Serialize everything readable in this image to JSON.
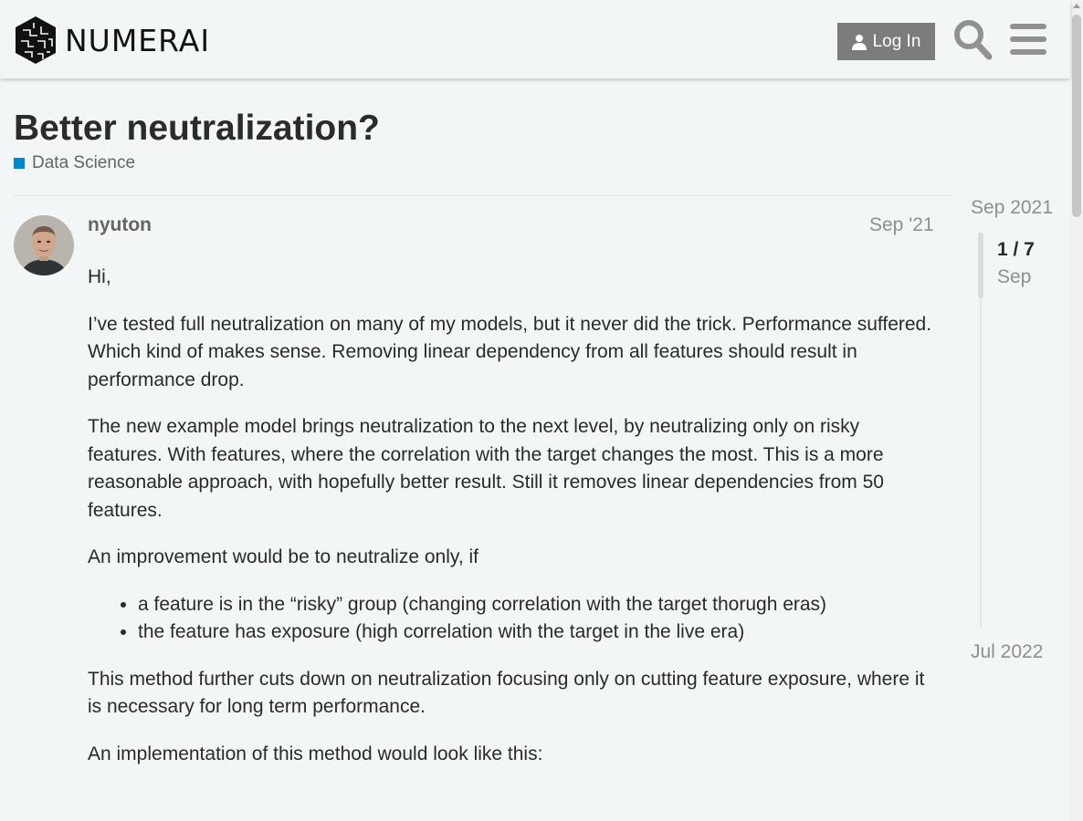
{
  "header": {
    "logo_text": "NUMERAI",
    "login_label": "Log In"
  },
  "topic": {
    "title": "Better neutralization?",
    "category": "Data Science",
    "category_color": "#0088cc"
  },
  "post": {
    "username": "nyuton",
    "date": "Sep '21",
    "greeting": "Hi,",
    "p1_line1": "I’ve tested full neutralization on many of my models, but it never did the trick. Performance suffered.",
    "p1_line2": "Which kind of makes sense. Removing linear dependency from all features should result in performance drop.",
    "p2": "The new example model brings neutralization to the next level, by neutralizing only on risky features. With features, where the correlation with the target changes the most. This is a more reasonable approach, with hopefully better result. Still it removes linear dependencies from 50 features.",
    "p3": "An improvement would be to neutralize only, if",
    "list": [
      "a feature is in the “risky” group (changing correlation with the target thorugh eras)",
      "the feature has exposure (high correlation with the target in the live era)"
    ],
    "p4": "This method further cuts down on neutralization focusing only on cutting feature exposure, where it is necessary for long term performance.",
    "p5": "An implementation of this method would look like this:"
  },
  "timeline": {
    "start": "Sep 2021",
    "position": "1 / 7",
    "current_month": "Sep",
    "end": "Jul 2022"
  },
  "icons": {
    "login": "user-icon",
    "search": "search-icon",
    "menu": "hamburger-icon"
  }
}
